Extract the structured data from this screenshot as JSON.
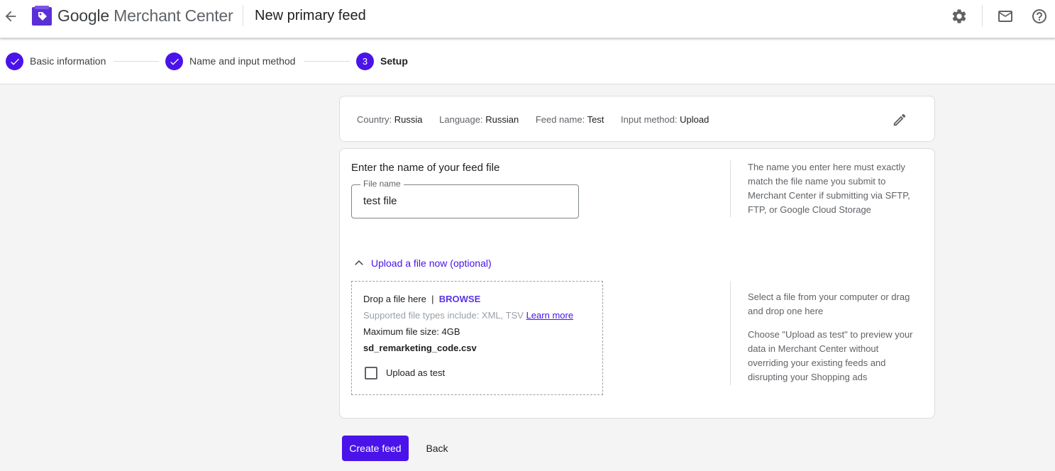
{
  "header": {
    "brand_google": "Google",
    "brand_rest": "Merchant Center",
    "title": "New primary feed"
  },
  "stepper": {
    "steps": [
      {
        "label": "Basic information",
        "state": "done"
      },
      {
        "label": "Name and input method",
        "state": "done"
      },
      {
        "label": "Setup",
        "state": "current",
        "number": "3"
      }
    ]
  },
  "summary": {
    "country_label": "Country:",
    "country_value": "Russia",
    "language_label": "Language:",
    "language_value": "Russian",
    "feedname_label": "Feed name:",
    "feedname_value": "Test",
    "method_label": "Input method:",
    "method_value": "Upload"
  },
  "file_section": {
    "title": "Enter the name of your feed file",
    "field_label": "File name",
    "field_value": "test file",
    "help": "The name you enter here must exactly match the file name you submit to Merchant Center if submitting via SFTP, FTP, or Google Cloud Storage"
  },
  "upload": {
    "expander_label": "Upload a file now (optional)",
    "drop_text": "Drop a file here",
    "separator": "|",
    "browse": "BROWSE",
    "supported": "Supported file types include: XML, TSV",
    "learn_more": "Learn more",
    "max_size": "Maximum file size: 4GB",
    "file_name": "sd_remarketing_code.csv",
    "checkbox_label": "Upload as test",
    "checkbox_checked": false,
    "help1": "Select a file from your computer or drag and drop one here",
    "help2": "Choose \"Upload as test\" to preview your data in Merchant Center without overriding your existing feeds and disrupting your Shopping ads"
  },
  "actions": {
    "create": "Create feed",
    "back": "Back"
  },
  "colors": {
    "accent": "#4a13ea"
  }
}
